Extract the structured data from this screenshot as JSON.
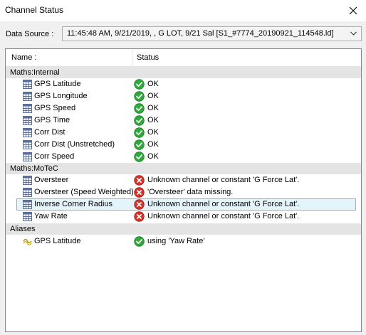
{
  "window": {
    "title": "Channel Status"
  },
  "data_source": {
    "label": "Data Source :",
    "value": "11:45:48 AM, 9/21/2019,  , G LOT, 9/21 Sal [S1_#7774_20190921_114548.ld]"
  },
  "columns": {
    "name": "Name :",
    "status": "Status"
  },
  "groups": [
    {
      "title": "Maths:Internal",
      "items": [
        {
          "name": "GPS Latitude",
          "status": "OK"
        },
        {
          "name": "GPS Longitude",
          "status": "OK"
        },
        {
          "name": "GPS Speed",
          "status": "OK"
        },
        {
          "name": "GPS Time",
          "status": "OK"
        },
        {
          "name": "Corr Dist",
          "status": "OK"
        },
        {
          "name": "Corr Dist (Unstretched)",
          "status": "OK"
        },
        {
          "name": "Corr Speed",
          "status": "OK"
        }
      ]
    },
    {
      "title": "Maths:MoTeC",
      "items": [
        {
          "name": "Oversteer",
          "status": "Unknown channel or constant 'G Force Lat'."
        },
        {
          "name": "Oversteer (Speed Weighted)",
          "status": "'Oversteer' data missing."
        },
        {
          "name": "Inverse Corner Radius",
          "status": "Unknown channel or constant 'G Force Lat'."
        },
        {
          "name": "Yaw Rate",
          "status": "Unknown channel or constant 'G Force Lat'."
        }
      ]
    },
    {
      "title": "Aliases",
      "items": [
        {
          "name": "GPS Latitude",
          "status": "using 'Yaw Rate'"
        }
      ]
    }
  ],
  "colors": {
    "ok": "#2eaa3a",
    "error": "#d9322b",
    "selection": "#e5f3fb",
    "group_bg": "#e4e4e4"
  }
}
